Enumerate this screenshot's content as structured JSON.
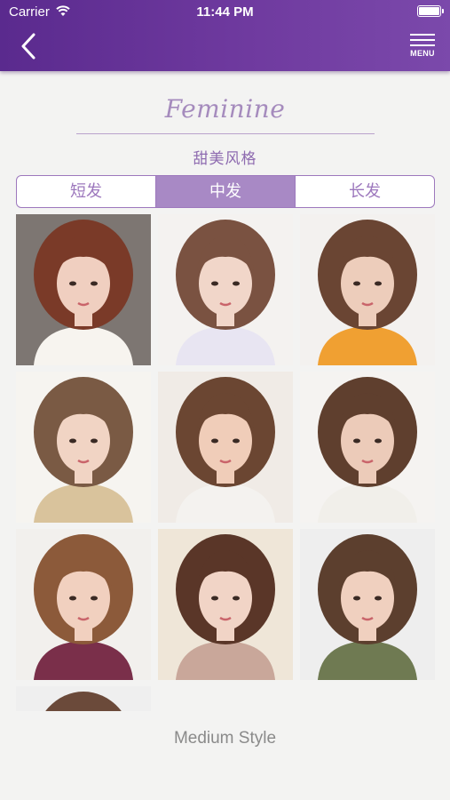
{
  "status_bar": {
    "carrier": "Carrier",
    "time": "11:44 PM"
  },
  "nav": {
    "menu_label": "MENU"
  },
  "heading": {
    "script_title": "Feminine",
    "subtitle": "甜美风格"
  },
  "tabs": [
    {
      "label": "短发",
      "active": false
    },
    {
      "label": "中发",
      "active": true
    },
    {
      "label": "长发",
      "active": false
    }
  ],
  "accent_color": "#a889c5",
  "hairstyles": [
    {
      "name": "photo-1"
    },
    {
      "name": "photo-2"
    },
    {
      "name": "photo-3"
    },
    {
      "name": "photo-4"
    },
    {
      "name": "photo-5"
    },
    {
      "name": "photo-6"
    },
    {
      "name": "photo-7"
    },
    {
      "name": "photo-8"
    },
    {
      "name": "photo-9"
    },
    {
      "name": "photo-10"
    }
  ],
  "footer": {
    "caption": "Medium Style"
  }
}
